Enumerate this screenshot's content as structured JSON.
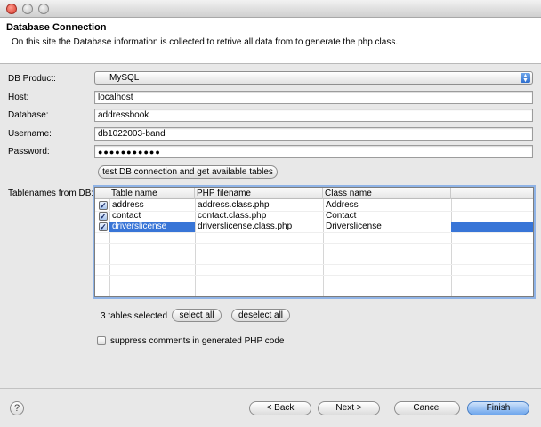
{
  "header": {
    "title": "Database Connection",
    "description": "On this site the Database information is collected to retrive all data from to generate the php class."
  },
  "form": {
    "db_product_label": "DB Product:",
    "db_product_value": "MySQL",
    "host_label": "Host:",
    "host_value": "localhost",
    "database_label": "Database:",
    "database_value": "addressbook",
    "username_label": "Username:",
    "username_value": "db1022003-band",
    "password_label": "Password:",
    "password_value": "●●●●●●●●●●●",
    "test_button": "test DB connection and get available tables"
  },
  "tables": {
    "label": "Tablenames from DB:",
    "columns": [
      "Table name",
      "PHP filename",
      "Class name"
    ],
    "rows": [
      {
        "checked": "✓",
        "name": "address",
        "php": "address.class.php",
        "class": "Address",
        "selected": false
      },
      {
        "checked": "✓",
        "name": "contact",
        "php": "contact.class.php",
        "class": "Contact",
        "selected": false
      },
      {
        "checked": "✓",
        "name": "driverslicense",
        "php": "driverslicense.class.php",
        "class": "Driverslicense",
        "selected": true
      }
    ],
    "count_text": "3 tables selected",
    "select_all": "select all",
    "deselect_all": "deselect all"
  },
  "options": {
    "suppress_comments": "suppress comments in generated PHP code"
  },
  "footer": {
    "help": "?",
    "back": "< Back",
    "next": "Next >",
    "cancel": "Cancel",
    "finish": "Finish"
  }
}
